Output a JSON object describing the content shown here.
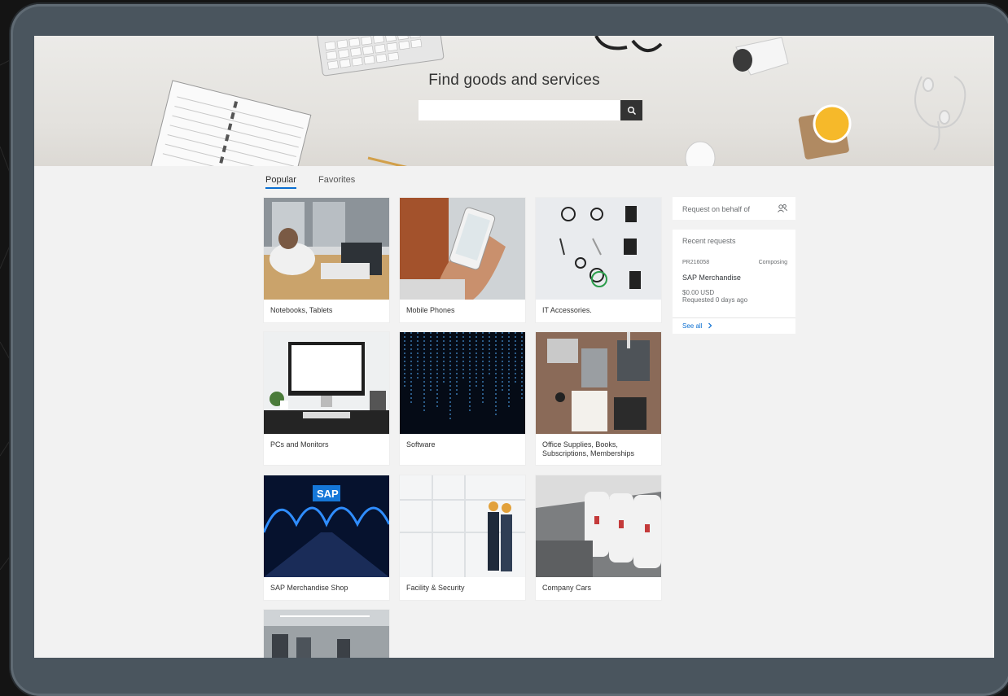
{
  "search": {
    "title": "Find goods and services",
    "placeholder": "",
    "value": ""
  },
  "tabs": [
    {
      "label": "Popular",
      "active": true
    },
    {
      "label": "Favorites",
      "active": false
    }
  ],
  "categories": [
    {
      "label": "Notebooks, Tablets"
    },
    {
      "label": "Mobile Phones"
    },
    {
      "label": "IT Accessories."
    },
    {
      "label": "PCs and Monitors"
    },
    {
      "label": "Software"
    },
    {
      "label": "Office Supplies, Books, Subscriptions, Memberships"
    },
    {
      "label": "SAP Merchandise Shop"
    },
    {
      "label": "Facility & Security"
    },
    {
      "label": "Company Cars"
    }
  ],
  "sidebar": {
    "request_on_behalf_label": "Request on behalf of",
    "recent": {
      "title": "Recent requests",
      "id": "PR216058",
      "status": "Composing",
      "name": "SAP Merchandise",
      "price": "$0.00 USD",
      "requested": "Requested 0 days ago",
      "see_all": "See all"
    }
  },
  "colors": {
    "accent": "#0a6ed1",
    "device_frame": "#4a555e",
    "page_background": "#f2f2f2",
    "search_button": "#333333"
  },
  "icons": [
    "search-icon",
    "person-group-icon",
    "chevron-right-icon"
  ]
}
